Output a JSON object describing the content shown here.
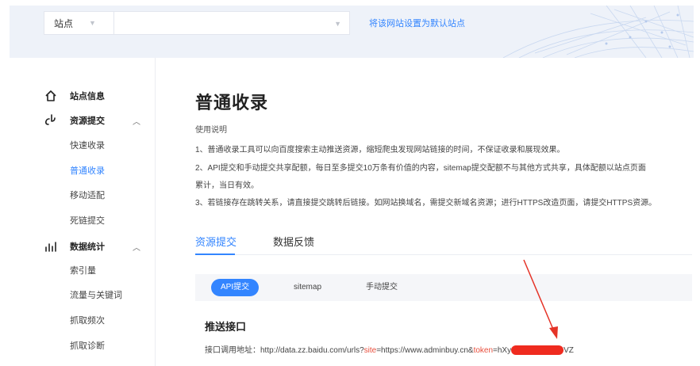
{
  "header": {
    "site_label": "站点",
    "site_select_value": "",
    "default_site_link": "将该网站设置为默认站点"
  },
  "sidebar": {
    "groups": [
      {
        "label": "站点信息",
        "icon": "home-icon",
        "expanded": false
      },
      {
        "label": "资源提交",
        "icon": "submit-icon",
        "expanded": true
      },
      {
        "label": "数据统计",
        "icon": "stats-icon",
        "expanded": true
      }
    ],
    "submit_items": [
      "快速收录",
      "普通收录",
      "移动适配",
      "死链提交"
    ],
    "stats_items": [
      "索引量",
      "流量与关键词",
      "抓取频次",
      "抓取诊断"
    ],
    "active_item": "普通收录"
  },
  "main": {
    "title": "普通收录",
    "usage_title": "使用说明",
    "usage_lines": [
      "1、普通收录工具可以向百度搜索主动推送资源，缩短爬虫发现网站链接的时间，不保证收录和展现效果。",
      "2、API提交和手动提交共享配额，每日至多提交10万条有价值的内容，sitemap提交配额不与其他方式共享，具体配额以站点页面",
      "累计，当日有效。",
      "3、若链接存在跳转关系，请直接提交跳转后链接。如网站换域名，需提交新域名资源；进行HTTPS改造页面，请提交HTTPS资源。"
    ],
    "tabs": [
      "资源提交",
      "数据反馈"
    ],
    "active_tab": "资源提交",
    "sub_tabs": [
      "API提交",
      "sitemap",
      "手动提交"
    ],
    "active_sub_tab": "API提交",
    "push_title": "推送接口",
    "api_label": "接口调用地址：",
    "api_url_prefix": "http://data.zz.baidu.com/urls?",
    "api_param_site": "site",
    "api_site_value": "=https://www.adminbuy.cn&",
    "api_param_token": "token",
    "api_token_start": "=hXy",
    "api_token_end": "VZ"
  },
  "colors": {
    "accent": "#3385ff",
    "param_red": "#e84e3c",
    "mask_red": "#ef2b1f",
    "banner_bg": "#eef2f9"
  }
}
